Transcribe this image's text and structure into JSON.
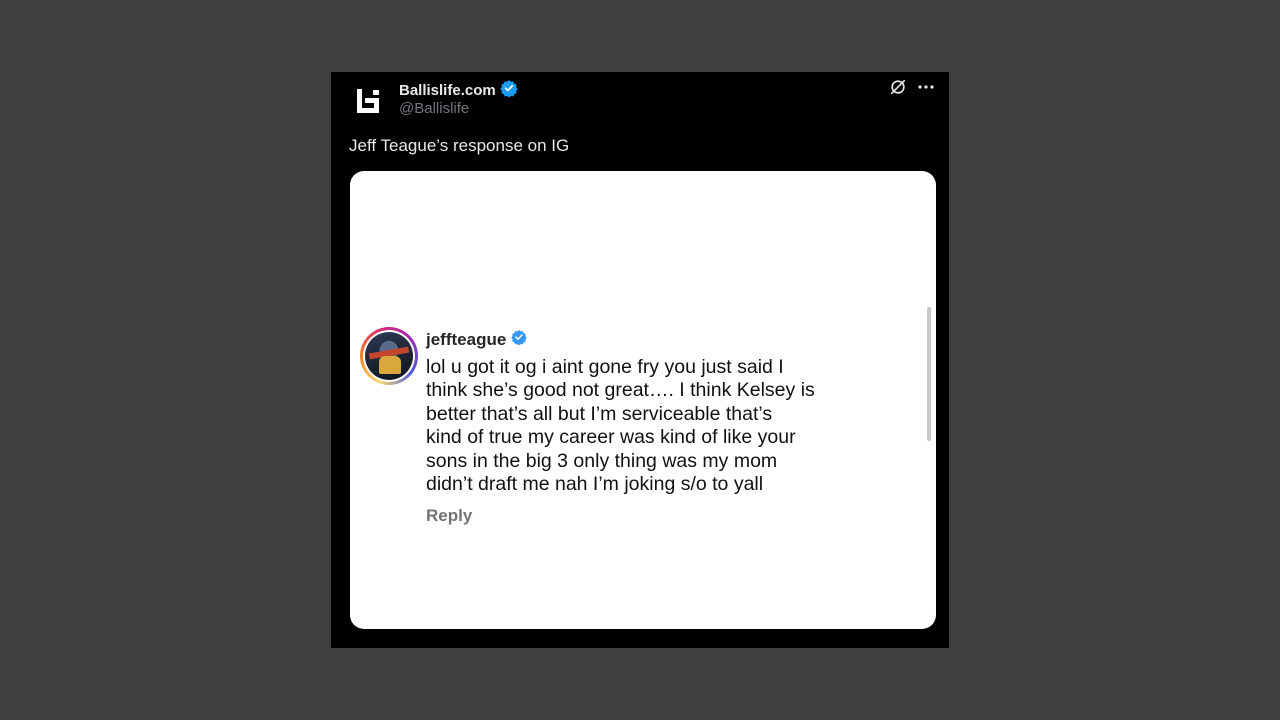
{
  "tweet": {
    "author_name": "Ballislife.com",
    "author_handle": "@Ballislife",
    "verified": true,
    "text": "Jeff Teague’s response on IG",
    "icons": {
      "logo": "ballislife-logo-icon",
      "verified": "verified-badge-icon",
      "grok": "grok-icon",
      "more": "more-options-icon"
    },
    "more_label": "···"
  },
  "instagram_comment": {
    "username": "jeffteague",
    "verified": true,
    "text": "lol u got it og i aint gone fry you just said I\nthink she’s good not great…. I think Kelsey is\nbetter that’s all but I’m serviceable that’s\nkind of true my career was kind of like your\nsons in the big 3 only thing was my mom\ndidn’t draft me nah I’m joking s/o to yall",
    "reply_label": "Reply"
  },
  "colors": {
    "page_background": "#404040",
    "card_background": "#000000",
    "verified_blue": "#1d9bf0",
    "ig_verified_blue": "#3897f0",
    "handle_gray": "#71767b",
    "reply_gray": "#737373"
  }
}
